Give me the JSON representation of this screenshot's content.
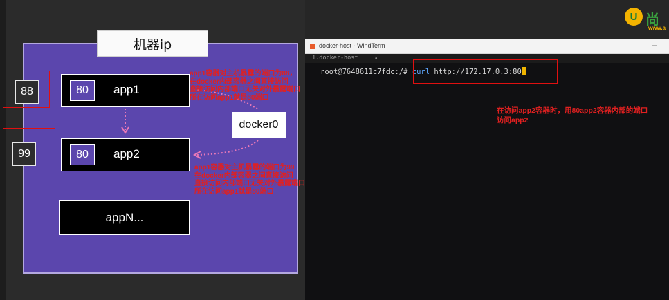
{
  "diagram": {
    "machine_title": "机器ip",
    "apps": [
      {
        "name": "app1",
        "port": "80"
      },
      {
        "name": "app2",
        "port": "80"
      },
      {
        "name": "appN..."
      }
    ],
    "host_ports": [
      "88",
      "99"
    ],
    "bridge": "docker0",
    "note_app1": [
      "app1容器对主机暴露的端口为88，",
      "在docker内部容器之间直接访问",
      "直接访问内部端口无关对外暴露端口",
      "所在访问app1就是80端口"
    ],
    "note_app2": [
      "app1容器对主机暴露的端口为99",
      "在docker内部容器之间直接访问",
      "直接访问内部端口无关对外暴露端口",
      "所在访问app1就是80端口"
    ]
  },
  "terminal": {
    "window_title": "docker-host - WindTerm",
    "minimize_glyph": "–",
    "tab_label": "1.docker-host",
    "tab_close": "×",
    "prompt": "root@7648611c7fdc:/# ",
    "command": "curl",
    "argument": " http://172.17.0.3:80"
  },
  "annotation": [
    "在访问app2容器时，用80app2容器内部的端口",
    "访问app2"
  ],
  "logo": {
    "mark": "U",
    "text": "尚",
    "sub": "www.a"
  },
  "colors": {
    "machine_bg": "#5b46ad",
    "red": "#e01010",
    "cursor": "#f0b400",
    "command": "#5fa8ff"
  }
}
